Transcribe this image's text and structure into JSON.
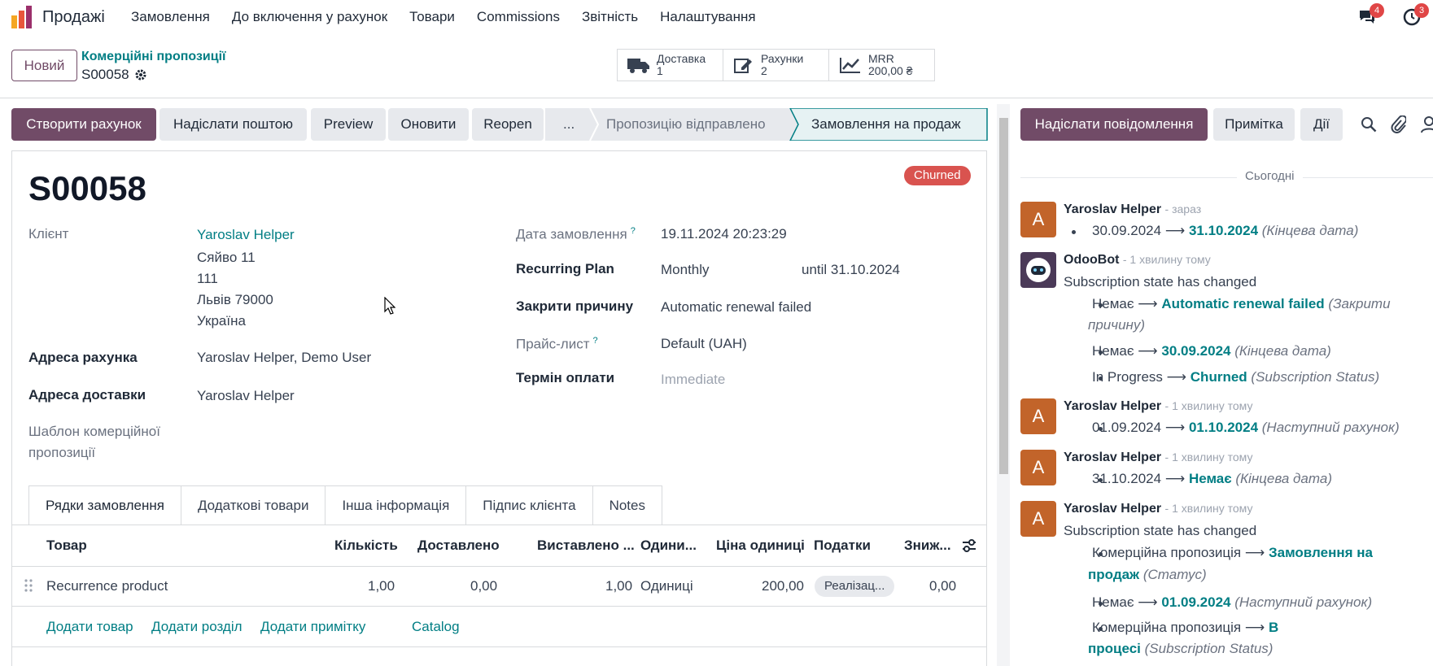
{
  "nav": {
    "app_name": "Продажі",
    "menu": [
      "Замовлення",
      "До включення у рахунок",
      "Товари",
      "Commissions",
      "Звітність",
      "Налаштування"
    ],
    "messages_count": "4",
    "activities_count": "3"
  },
  "control": {
    "new_label": "Новий",
    "breadcrumb_parent": "Комерційні пропозиції",
    "breadcrumb_current": "S00058",
    "smart_buttons": [
      {
        "label": "Доставка",
        "value": "1"
      },
      {
        "label": "Рахунки",
        "value": "2"
      },
      {
        "label": "MRR",
        "value": "200,00 ₴"
      }
    ]
  },
  "actions": {
    "create_invoice": "Створити рахунок",
    "send_email": "Надіслати поштою",
    "preview": "Preview",
    "update": "Оновити",
    "reopen": "Reopen"
  },
  "stages": {
    "more": "...",
    "sent": "Пропозицію відправлено",
    "sale": "Замовлення на продаж"
  },
  "record": {
    "name": "S00058",
    "status_badge": "Churned",
    "customer_label": "Клієнт",
    "customer_name": "Yaroslav Helper",
    "address_lines": [
      "Сяйво 11",
      "111",
      "Львів 79000",
      "Україна"
    ],
    "invoice_address_label": "Адреса рахунка",
    "invoice_address": "Yaroslav Helper, Demo User",
    "delivery_address_label": "Адреса доставки",
    "delivery_address": "Yaroslav Helper",
    "template_label_1": "Шаблон комерційної",
    "template_label_2": "пропозиції",
    "order_date_label": "Дата замовлення",
    "order_date": "19.11.2024 20:23:29",
    "recurring_label": "Recurring Plan",
    "recurring_plan": "Monthly",
    "until_text": "until 31.10.2024",
    "close_reason_label": "Закрити причину",
    "close_reason": "Automatic renewal failed",
    "pricelist_label": "Прайс-лист",
    "pricelist": "Default (UAH)",
    "payment_terms_label": "Термін оплати",
    "payment_terms": "Immediate",
    "help_mark": "?"
  },
  "tabs": [
    "Рядки замовлення",
    "Додаткові товари",
    "Інша інформація",
    "Підпис клієнта",
    "Notes"
  ],
  "order_lines": {
    "headers": {
      "product": "Товар",
      "qty": "Кількість",
      "delivered": "Доставлено",
      "invoiced": "Виставлено ...",
      "uom": "Одини...",
      "price": "Ціна одиниці",
      "taxes": "Податки",
      "discount": "Зниж..."
    },
    "row": {
      "product": "Recurrence product",
      "qty": "1,00",
      "delivered": "0,00",
      "invoiced": "1,00",
      "uom": "Одиниці",
      "price": "200,00",
      "taxes": "Реалізац...",
      "discount": "0,00"
    },
    "add_links": {
      "add_product": "Додати товар",
      "add_section": "Додати розділ",
      "add_note": "Додати примітку",
      "catalog": "Catalog"
    }
  },
  "chatter": {
    "send_message": "Надіслати повідомлення",
    "note": "Примітка",
    "activities": "Дії",
    "today": "Сьогодні",
    "arrow": "⟶",
    "messages": [
      {
        "initial": "A",
        "author": "Yaroslav Helper",
        "when": "- зараз",
        "lines": [
          {
            "old": "30.09.2024",
            "new": "31.10.2024",
            "field": "(Кінцева дата)"
          }
        ]
      },
      {
        "author": "OdooBot",
        "when": "- 1 хвилину тому",
        "body": "Subscription state has changed",
        "lines": [
          {
            "old": "Немає",
            "new": "Automatic renewal failed",
            "field": "(Закрити",
            "field_cont": "причину)"
          },
          {
            "old": "Немає",
            "new": "30.09.2024",
            "field": "(Кінцева дата)"
          },
          {
            "old": "In Progress",
            "new": "Churned",
            "field": "(Subscription Status)"
          }
        ]
      },
      {
        "initial": "A",
        "author": "Yaroslav Helper",
        "when": "- 1 хвилину тому",
        "lines": [
          {
            "old": "01.09.2024",
            "new": "01.10.2024",
            "field": "(Наступний рахунок)"
          }
        ]
      },
      {
        "initial": "A",
        "author": "Yaroslav Helper",
        "when": "- 1 хвилину тому",
        "lines": [
          {
            "old": "31.10.2024",
            "new": "Немає",
            "field": "(Кінцева дата)"
          }
        ]
      },
      {
        "initial": "A",
        "author": "Yaroslav Helper",
        "when": "- 1 хвилину тому",
        "body": "Subscription state has changed",
        "lines": [
          {
            "old": "Комерційна пропозиція",
            "new": "Замовлення на",
            "new_cont": "продаж",
            "field": "(Статус)"
          },
          {
            "old": "Немає",
            "new": "01.09.2024",
            "field": "(Наступний рахунок)"
          },
          {
            "old": "Комерційна пропозиція",
            "new": "В",
            "new_cont": "процесі",
            "field": "(Subscription Status)"
          }
        ]
      }
    ]
  }
}
